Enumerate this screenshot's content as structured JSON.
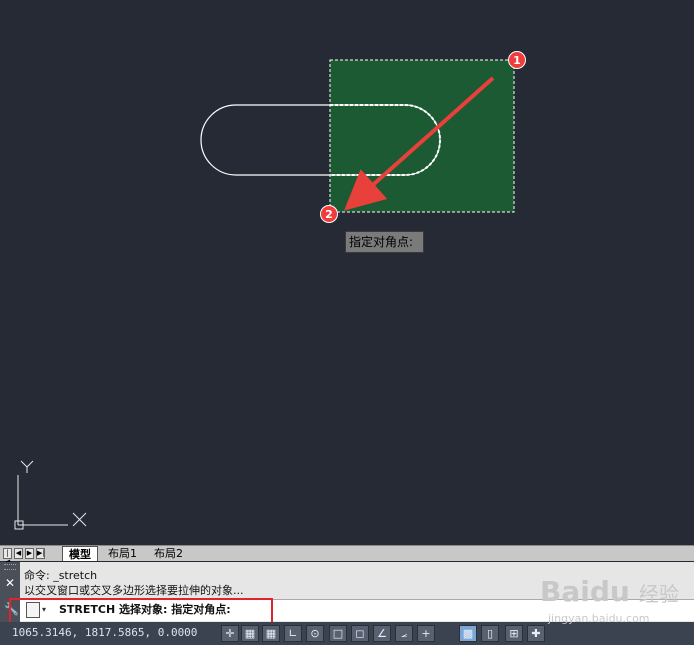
{
  "canvas": {
    "tooltip": "指定对角点:",
    "markers": [
      "1",
      "2"
    ],
    "ucs": {
      "y_label": "Y",
      "x_label": "X"
    },
    "colors": {
      "background": "#252a35",
      "window": "#1b5a32",
      "arrow": "#e8403a",
      "marker": "#f03c3c",
      "entity": "#ffffff"
    }
  },
  "tabs": {
    "nav": [
      "|◀",
      "◀",
      "▶",
      "▶|"
    ],
    "items": [
      "模型",
      "布局1",
      "布局2"
    ]
  },
  "command": {
    "history": [
      "命令: _stretch",
      "以交叉窗口或交叉多边形选择要拉伸的对象..."
    ],
    "close_glyph": "✕",
    "current": "STRETCH 选择对象: 指定对角点:"
  },
  "status": {
    "coordinates": "1065.3146,  1817.5865,  0.0000",
    "buttons": [
      "✛",
      "▦",
      "▦",
      "∟",
      "⊙",
      "□",
      "◻",
      "∠",
      "⦟",
      "+",
      "▩",
      "▯",
      "⊞",
      "✚"
    ]
  },
  "watermark": {
    "brand": "Baidu",
    "cn": "经验",
    "url": "jingyan.baidu.com"
  }
}
